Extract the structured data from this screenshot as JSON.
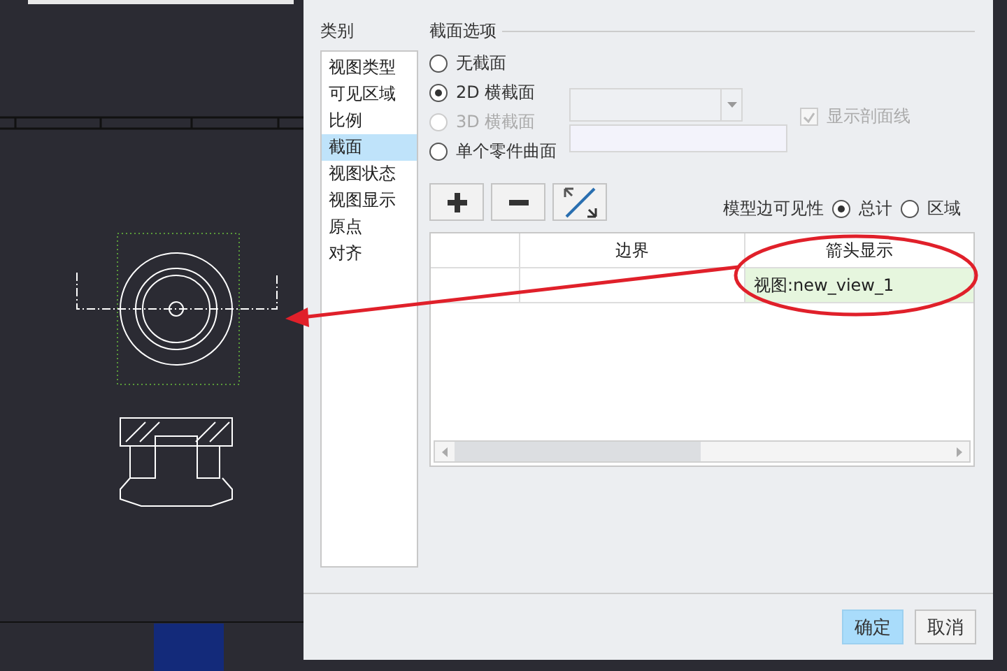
{
  "category": {
    "label": "类别",
    "items": [
      {
        "label": "视图类型",
        "selected": false
      },
      {
        "label": "可见区域",
        "selected": false
      },
      {
        "label": "比例",
        "selected": false
      },
      {
        "label": "截面",
        "selected": true
      },
      {
        "label": "视图状态",
        "selected": false
      },
      {
        "label": "视图显示",
        "selected": false
      },
      {
        "label": "原点",
        "selected": false
      },
      {
        "label": "对齐",
        "selected": false
      }
    ]
  },
  "section_options": {
    "title": "截面选项",
    "options": [
      {
        "kind": "plain",
        "label": "无截面",
        "selected": false,
        "disabled": false
      },
      {
        "kind": "dropdown",
        "label": "2D 横截面",
        "selected": true,
        "disabled": false
      },
      {
        "kind": "plain",
        "label": "3D 横截面",
        "selected": false,
        "disabled": true
      },
      {
        "kind": "field",
        "label": "单个零件曲面",
        "selected": false,
        "disabled": false
      }
    ],
    "dropdown_disabled": true,
    "hatch_checkbox": {
      "label": "显示剖面线",
      "checked": true,
      "disabled": true
    }
  },
  "tools": [
    {
      "kind": "add"
    },
    {
      "kind": "remove"
    },
    {
      "kind": "flip"
    }
  ],
  "edge_visibility": {
    "label": "模型边可见性",
    "options": [
      {
        "label": "总计",
        "selected": true
      },
      {
        "label": "区域",
        "selected": false
      }
    ]
  },
  "table": {
    "columns": [
      "边界",
      "箭头显示"
    ],
    "rows": [
      {
        "arrow_display": "视图:new_view_1",
        "highlighted": true
      }
    ]
  },
  "buttons": [
    {
      "label": "确定",
      "kind": "primary"
    },
    {
      "label": "取消",
      "kind": "default"
    }
  ]
}
